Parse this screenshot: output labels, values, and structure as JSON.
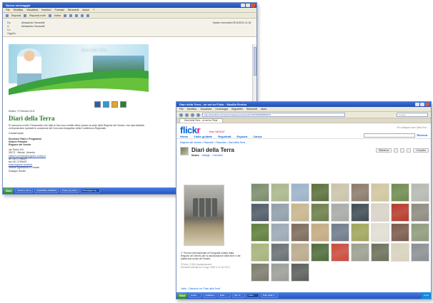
{
  "email_window": {
    "title": "Nuovo messaggio",
    "menu": [
      "File",
      "Modifica",
      "Visualizza",
      "Inserisci",
      "Formato",
      "Strumenti",
      "Azioni",
      "?"
    ],
    "toolbar": [
      "Rispondi",
      "Rispondi a tutti",
      "Inoltra"
    ],
    "header": {
      "from_label": "Da:",
      "from_value": "Alessandro Tomasetti",
      "to_label": "A:",
      "to_value": "Alessandro Tomasetti",
      "cc_label": "Cc:",
      "subject_label": "Oggetto:",
      "sent_label": "Inviato:",
      "sent_value": "mercoledì 09/11/2011 11:18"
    },
    "banner_tagline": "Diari della Terra",
    "letter": {
      "date": "Mestre, 9 Febbraio 2011",
      "title": "Diari della Terra",
      "paragraph": "Si comunica a tutti i Fotoamatori che tutte le foto sono visibili online presso la sede della Regione del Veneto, che sarà allestita un'esposizione speciale in occasione del Concorso fotografico della Conferenza Regionale.",
      "greeting": "Cordiali saluti,",
      "sig1": "Direzione Piani e Programmi",
      "sig2": "Settore Primario",
      "sig3": "Regione del Veneto",
      "addr1": "via Torino 110",
      "addr2": "30172 - Mestre, Venezia",
      "email": "settore.primario@regione.veneto.it",
      "tel": "tel. 041 2795419",
      "fax": "fax 041 2795425",
      "web": "www.regione.veneto.it",
      "sector1": "Settore Agricoltura e Foreste",
      "sector2": "Sviluppo Rurale"
    }
  },
  "ff_window": {
    "title": "Diari della Terra - un set su Flickr - Mozilla Firefox",
    "menu": [
      "File",
      "Modifica",
      "Visualizza",
      "Cronologia",
      "Segnalibri",
      "Strumenti",
      "Aiuto"
    ],
    "url": "http://www.flickr.com/photos/regioneveneto/sets/72157625928369372/",
    "search_placeholder": "Google",
    "tab": "Diari della Terra - un set su Flickr"
  },
  "flickr": {
    "logo_a": "flick",
    "logo_b": "r",
    "yahoo": "from YAHOO!",
    "signed_in": "Sei collegato come",
    "signed_links": [
      "Aiuto",
      "Esci"
    ],
    "nav": [
      "Home",
      "Visite guidate",
      "Registrati",
      "Esplora",
      "Carica"
    ],
    "search_link": "Ricerca",
    "breadcrumb": "Regione del Veneto > Raccolte > Raccolta > Diari della Terra",
    "set_title": "Diari della Terra",
    "subtabs": [
      "Mostra",
      "Dettagli",
      "Commenti"
    ],
    "slideshow": "Slideshow",
    "view_label": "Completo",
    "description": "1° Premio Internazionale di Fotografia indetto dalla Regione del Veneto per la valorizzazione delle terre e del patrimonio rurale del Veneto.",
    "meta1": "29 foto | 2,504 visualizzazioni",
    "meta2": "Elementi caricati tra 14 ago 2009 e 11 dic 2010",
    "footer": "Visita - Collezioni con \"Diari della Terra\""
  },
  "photo_colors": [
    "#7a8c6a",
    "#a9b58a",
    "#9bb1c7",
    "#5a6e3a",
    "#c9c3a8",
    "#8a7a6a",
    "#d0c59e",
    "#6e8a4e",
    "#b4b8b0",
    "#4e5a66",
    "#8f9da8",
    "#c7b48a",
    "#6b7d4a",
    "#a7a9a6",
    "#3f4a52",
    "#d8d2c6",
    "#b53a2a",
    "#8c8a7e",
    "#5e7e3a",
    "#9aa7b3",
    "#7c6a5a",
    "#c2a980",
    "#6d7a8a",
    "#a0a45a",
    "#e0ddd2",
    "#7a5a4a",
    "#8d9a7a",
    "#a6b27a",
    "#676f74",
    "#b9a88a",
    "#4e6a3a",
    "#c94a3a",
    "#9a9e8e",
    "#6a6f5a",
    "#d7d1bd",
    "#8a8e92",
    "#7b7a6a",
    "#9a9c98",
    "#5a5e5a"
  ],
  "taskbar": {
    "start": "Start",
    "email_tasks": [
      "Posta in arrivo",
      "DIARIDELLATERRA",
      "Press_Kit_Diari",
      "Messaggio Ag..."
    ],
    "ff_tasks": [
      "Posta",
      "Vodafone",
      "Diari...",
      "Sim O...",
      "Flickr",
      "Diari della T..."
    ],
    "email_clock": "11:31",
    "ff_clock": "11:33"
  }
}
